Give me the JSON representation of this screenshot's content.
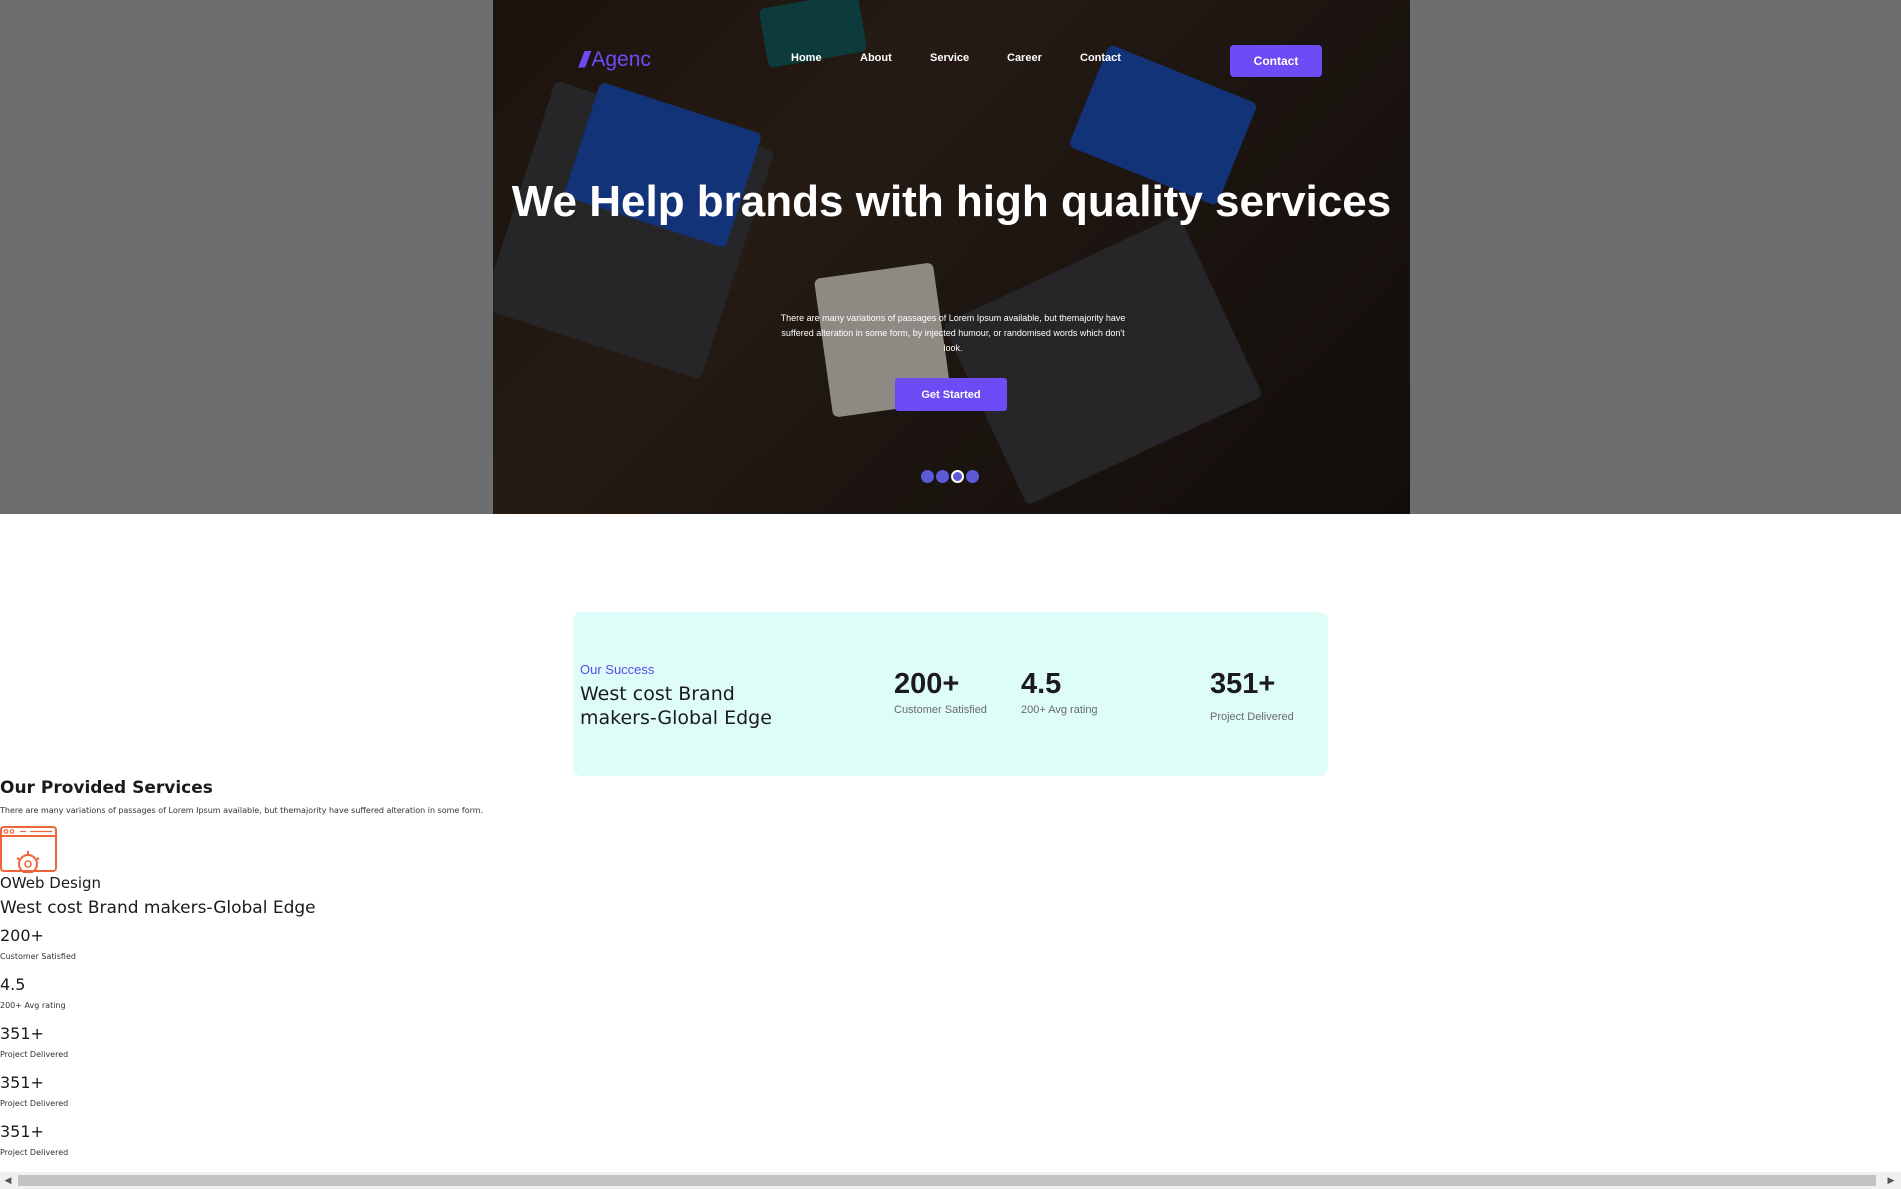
{
  "brand": {
    "logo_mark": "///",
    "name": "Agenc",
    "accent_color": "#6c4cf5"
  },
  "nav": {
    "items": [
      {
        "label": "Home"
      },
      {
        "label": "About"
      },
      {
        "label": "Service"
      },
      {
        "label": "Career"
      },
      {
        "label": "Contact"
      }
    ],
    "contact_button": "Contact"
  },
  "hero": {
    "title": "We Help brands with high quality services",
    "subtitle": "There are many variations of passages of Lorem Ipsum available, but themajority have suffered alteration in some form, by injected humour, or randomised words which don't look.",
    "cta_label": "Get Started",
    "slides": {
      "count": 4,
      "active_index": 2
    }
  },
  "success": {
    "eyebrow": "Our Success",
    "title": "West cost Brand makers-Global Edge",
    "stats": [
      {
        "value": "200+",
        "label": "Customer Satisfied"
      },
      {
        "value": "4.5",
        "label": "200+ Avg rating"
      },
      {
        "value": "351+",
        "label": "Project Delivered"
      }
    ],
    "background_color": "#dffdf8"
  },
  "services": {
    "heading": "Our Provided Services",
    "description": "There are many variations of passages of Lorem Ipsum available, but themajority have suffered alteration in some form.",
    "item_title": "OWeb Design",
    "icon_color": "#f0643c"
  },
  "duplicate": {
    "title": "West cost Brand makers-Global Edge",
    "stats": [
      {
        "value": "200+",
        "label": "Customer Satisfied"
      },
      {
        "value": "4.5",
        "label": "200+ Avg rating"
      },
      {
        "value": "351+",
        "label": "Project Delivered"
      },
      {
        "value": "351+",
        "label": "Project Delivered"
      },
      {
        "value": "351+",
        "label": "Project Delivered"
      }
    ]
  },
  "scrollbar": {
    "left_arrow": "◀",
    "right_arrow": "▶"
  }
}
